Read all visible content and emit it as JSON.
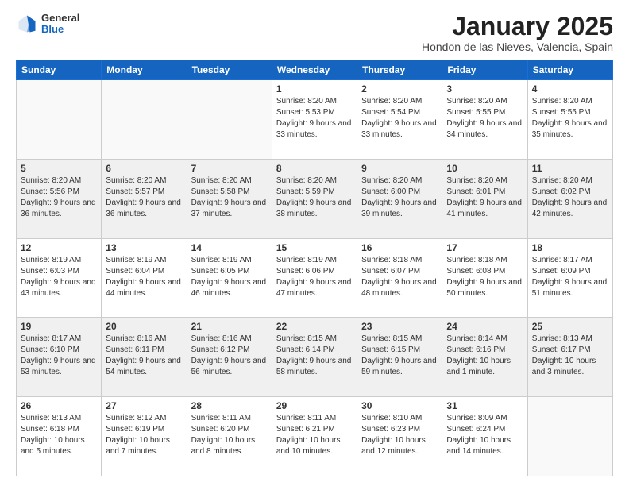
{
  "header": {
    "logo_general": "General",
    "logo_blue": "Blue",
    "month_title": "January 2025",
    "location": "Hondon de las Nieves, Valencia, Spain"
  },
  "weekdays": [
    "Sunday",
    "Monday",
    "Tuesday",
    "Wednesday",
    "Thursday",
    "Friday",
    "Saturday"
  ],
  "weeks": [
    {
      "shaded": false,
      "days": [
        {
          "num": "",
          "info": ""
        },
        {
          "num": "",
          "info": ""
        },
        {
          "num": "",
          "info": ""
        },
        {
          "num": "1",
          "info": "Sunrise: 8:20 AM\nSunset: 5:53 PM\nDaylight: 9 hours and 33 minutes."
        },
        {
          "num": "2",
          "info": "Sunrise: 8:20 AM\nSunset: 5:54 PM\nDaylight: 9 hours and 33 minutes."
        },
        {
          "num": "3",
          "info": "Sunrise: 8:20 AM\nSunset: 5:55 PM\nDaylight: 9 hours and 34 minutes."
        },
        {
          "num": "4",
          "info": "Sunrise: 8:20 AM\nSunset: 5:55 PM\nDaylight: 9 hours and 35 minutes."
        }
      ]
    },
    {
      "shaded": true,
      "days": [
        {
          "num": "5",
          "info": "Sunrise: 8:20 AM\nSunset: 5:56 PM\nDaylight: 9 hours and 36 minutes."
        },
        {
          "num": "6",
          "info": "Sunrise: 8:20 AM\nSunset: 5:57 PM\nDaylight: 9 hours and 36 minutes."
        },
        {
          "num": "7",
          "info": "Sunrise: 8:20 AM\nSunset: 5:58 PM\nDaylight: 9 hours and 37 minutes."
        },
        {
          "num": "8",
          "info": "Sunrise: 8:20 AM\nSunset: 5:59 PM\nDaylight: 9 hours and 38 minutes."
        },
        {
          "num": "9",
          "info": "Sunrise: 8:20 AM\nSunset: 6:00 PM\nDaylight: 9 hours and 39 minutes."
        },
        {
          "num": "10",
          "info": "Sunrise: 8:20 AM\nSunset: 6:01 PM\nDaylight: 9 hours and 41 minutes."
        },
        {
          "num": "11",
          "info": "Sunrise: 8:20 AM\nSunset: 6:02 PM\nDaylight: 9 hours and 42 minutes."
        }
      ]
    },
    {
      "shaded": false,
      "days": [
        {
          "num": "12",
          "info": "Sunrise: 8:19 AM\nSunset: 6:03 PM\nDaylight: 9 hours and 43 minutes."
        },
        {
          "num": "13",
          "info": "Sunrise: 8:19 AM\nSunset: 6:04 PM\nDaylight: 9 hours and 44 minutes."
        },
        {
          "num": "14",
          "info": "Sunrise: 8:19 AM\nSunset: 6:05 PM\nDaylight: 9 hours and 46 minutes."
        },
        {
          "num": "15",
          "info": "Sunrise: 8:19 AM\nSunset: 6:06 PM\nDaylight: 9 hours and 47 minutes."
        },
        {
          "num": "16",
          "info": "Sunrise: 8:18 AM\nSunset: 6:07 PM\nDaylight: 9 hours and 48 minutes."
        },
        {
          "num": "17",
          "info": "Sunrise: 8:18 AM\nSunset: 6:08 PM\nDaylight: 9 hours and 50 minutes."
        },
        {
          "num": "18",
          "info": "Sunrise: 8:17 AM\nSunset: 6:09 PM\nDaylight: 9 hours and 51 minutes."
        }
      ]
    },
    {
      "shaded": true,
      "days": [
        {
          "num": "19",
          "info": "Sunrise: 8:17 AM\nSunset: 6:10 PM\nDaylight: 9 hours and 53 minutes."
        },
        {
          "num": "20",
          "info": "Sunrise: 8:16 AM\nSunset: 6:11 PM\nDaylight: 9 hours and 54 minutes."
        },
        {
          "num": "21",
          "info": "Sunrise: 8:16 AM\nSunset: 6:12 PM\nDaylight: 9 hours and 56 minutes."
        },
        {
          "num": "22",
          "info": "Sunrise: 8:15 AM\nSunset: 6:14 PM\nDaylight: 9 hours and 58 minutes."
        },
        {
          "num": "23",
          "info": "Sunrise: 8:15 AM\nSunset: 6:15 PM\nDaylight: 9 hours and 59 minutes."
        },
        {
          "num": "24",
          "info": "Sunrise: 8:14 AM\nSunset: 6:16 PM\nDaylight: 10 hours and 1 minute."
        },
        {
          "num": "25",
          "info": "Sunrise: 8:13 AM\nSunset: 6:17 PM\nDaylight: 10 hours and 3 minutes."
        }
      ]
    },
    {
      "shaded": false,
      "days": [
        {
          "num": "26",
          "info": "Sunrise: 8:13 AM\nSunset: 6:18 PM\nDaylight: 10 hours and 5 minutes."
        },
        {
          "num": "27",
          "info": "Sunrise: 8:12 AM\nSunset: 6:19 PM\nDaylight: 10 hours and 7 minutes."
        },
        {
          "num": "28",
          "info": "Sunrise: 8:11 AM\nSunset: 6:20 PM\nDaylight: 10 hours and 8 minutes."
        },
        {
          "num": "29",
          "info": "Sunrise: 8:11 AM\nSunset: 6:21 PM\nDaylight: 10 hours and 10 minutes."
        },
        {
          "num": "30",
          "info": "Sunrise: 8:10 AM\nSunset: 6:23 PM\nDaylight: 10 hours and 12 minutes."
        },
        {
          "num": "31",
          "info": "Sunrise: 8:09 AM\nSunset: 6:24 PM\nDaylight: 10 hours and 14 minutes."
        },
        {
          "num": "",
          "info": ""
        }
      ]
    }
  ]
}
